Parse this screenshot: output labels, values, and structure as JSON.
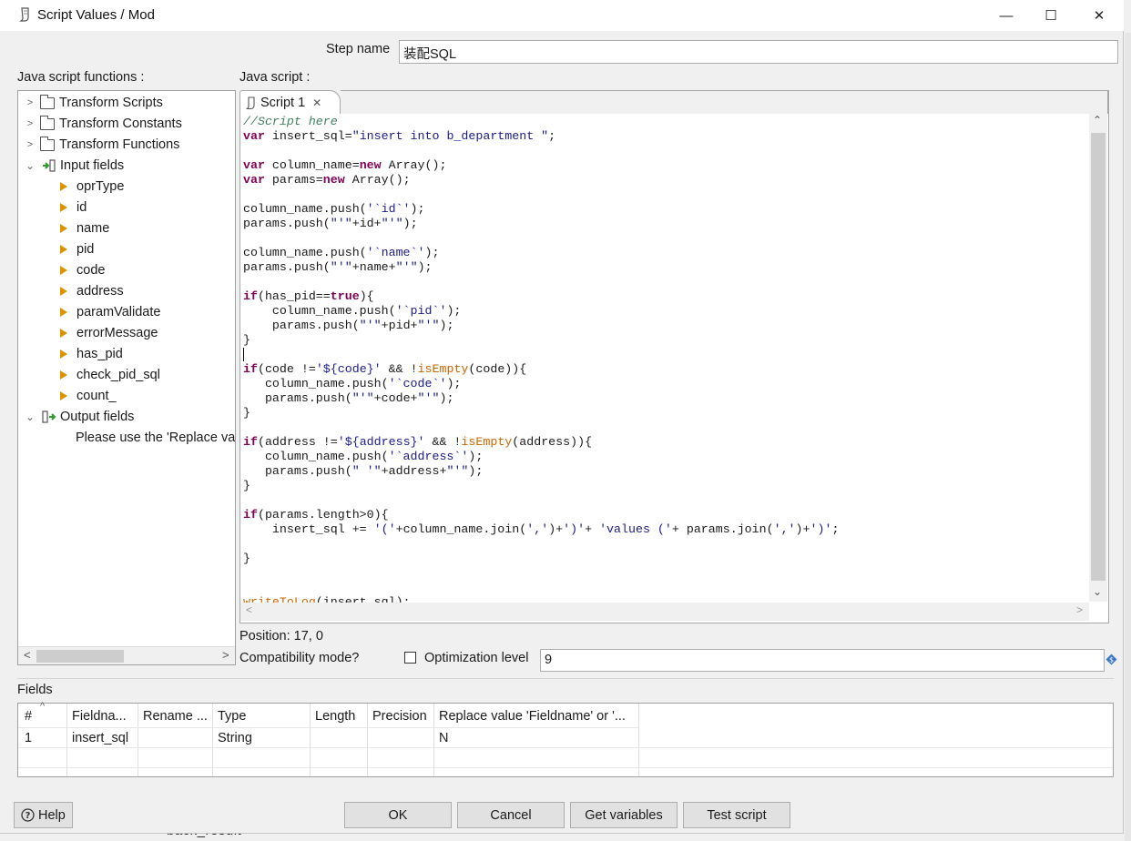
{
  "window": {
    "title": "Script Values / Mod",
    "minimize": "—",
    "maximize": "☐",
    "close": "✕"
  },
  "step_name": {
    "label": "Step name",
    "value": "装配SQL"
  },
  "functions_panel": {
    "label": "Java script functions :",
    "folders": [
      "Transform Scripts",
      "Transform Constants",
      "Transform Functions"
    ],
    "input_fields_label": "Input fields",
    "input_fields": [
      "oprType",
      "id",
      "name",
      "pid",
      "code",
      "address",
      "paramValidate",
      "errorMessage",
      "has_pid",
      "check_pid_sql",
      "count_"
    ],
    "output_fields_label": "Output fields",
    "output_note": "Please use the 'Replace value 'Fieldname' or 'Rename to'' options"
  },
  "script_panel": {
    "label": "Java script :",
    "tab_label": "Script 1",
    "position": "Position: 17, 0",
    "compat_label": "Compatibility mode?",
    "optimization_label": "Optimization level",
    "optimization_value": "9"
  },
  "code_lines": [
    "//Script here",
    "var insert_sql=\"insert into b_department \";",
    "",
    "var column_name=new Array();",
    "var params=new Array();",
    "",
    "column_name.push('`id`');",
    "params.push(\"'\"+id+\"'\");",
    "",
    "column_name.push('`name`');",
    "params.push(\"'\"+name+\"'\");",
    "",
    "if(has_pid==true){",
    "    column_name.push('`pid`');",
    "    params.push(\"'\"+pid+\"'\");",
    "}",
    "",
    "if(code !='${code}' && !isEmpty(code)){",
    "   column_name.push('`code`');",
    "   params.push(\"'\"+code+\"'\");",
    "}",
    "",
    "if(address !='${address}' && !isEmpty(address)){",
    "   column_name.push('`address`');",
    "   params.push(\" '\"+address+\"'\");",
    "}",
    "",
    "if(params.length>0){",
    "    insert_sql += '('+column_name.join(',')+')'+ 'values ('+ params.join(',')+')';",
    "",
    "}",
    "",
    "",
    "writeToLog(insert_sql);"
  ],
  "fields_section": {
    "label": "Fields",
    "columns": [
      "#",
      "Fieldna...",
      "Rename ...",
      "Type",
      "Length",
      "Precision",
      "Replace value 'Fieldname' or '..."
    ],
    "rows": [
      {
        "num": "1",
        "fieldname": "insert_sql",
        "rename": "",
        "type": "String",
        "length": "",
        "precision": "",
        "replace": "N"
      }
    ]
  },
  "buttons": {
    "help": "Help",
    "ok": "OK",
    "cancel": "Cancel",
    "get_variables": "Get variables",
    "test_script": "Test script"
  },
  "background_window": {
    "text": "back_result"
  },
  "colors": {
    "keyword": "#7f0055",
    "comment": "#3f7f5f",
    "string": "#1a1a8c",
    "builtin": "#cc6600",
    "field_arrow": "#d99400"
  }
}
